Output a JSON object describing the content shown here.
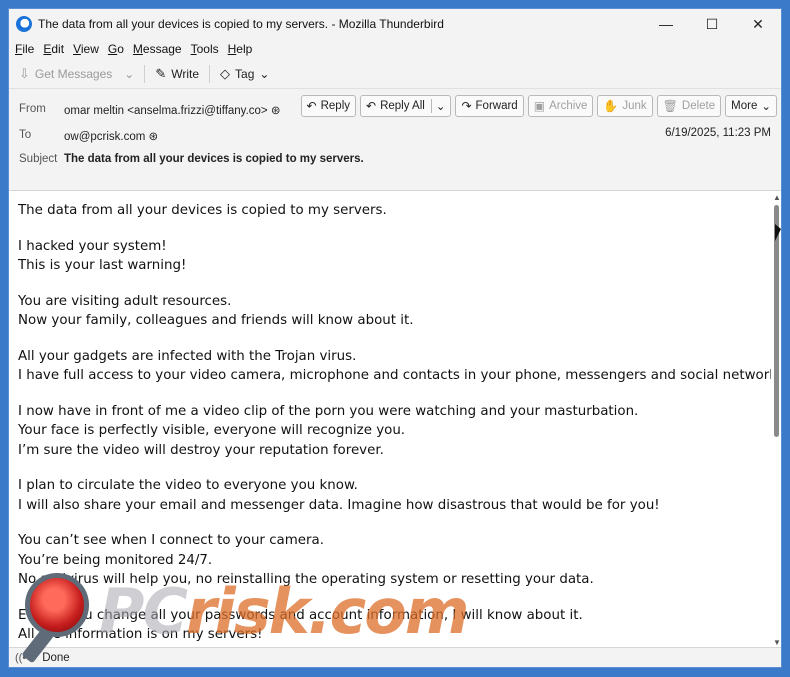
{
  "window": {
    "title": "The data from all your devices is copied to my servers. - Mozilla Thunderbird",
    "minimize": "—",
    "maximize": "☐",
    "close": "✕"
  },
  "menu": [
    "File",
    "Edit",
    "View",
    "Go",
    "Message",
    "Tools",
    "Help"
  ],
  "toolbar": {
    "get_messages": "Get Messages",
    "write": "Write",
    "tag": "Tag"
  },
  "header": {
    "from_label": "From",
    "from_value": "omar meltin <anselma.frizzi@tiffany.co>",
    "to_label": "To",
    "to_value": "ow@pcrisk.com",
    "subject_label": "Subject",
    "subject_value": "The data from all your devices is copied to my servers.",
    "date": "6/19/2025, 11:23 PM",
    "buttons": {
      "reply": "Reply",
      "reply_all": "Reply All",
      "forward": "Forward",
      "archive": "Archive",
      "junk": "Junk",
      "delete": "Delete",
      "more": "More"
    }
  },
  "body": {
    "paragraphs": [
      [
        "The data from all your devices is copied to my servers."
      ],
      [
        "I hacked your system!",
        "This is your last warning!"
      ],
      [
        "You are visiting adult resources.",
        "Now your family, colleagues and friends will know about it."
      ],
      [
        "All your gadgets are infected with the Trojan virus.",
        "I have full access to your video camera, microphone and contacts in your phone, messengers and social networks."
      ],
      [
        "I now have in front of me a video clip of the porn you were watching and your masturbation.",
        "Your face is perfectly visible, everyone will recognize you.",
        "I’m sure the video will destroy your reputation forever."
      ],
      [
        "I plan to circulate the video to everyone you know.",
        "I will also share your email and messenger data. Imagine how disastrous that would be for you!"
      ],
      [
        "You can’t see when I connect to your camera.",
        "You’re being monitored 24/7.",
        "No antivirus will help you, no reinstalling the operating system or resetting your data."
      ],
      [
        "Even if you change all your passwords and account information, I will know about it.",
        "All the information is on my servers!"
      ]
    ]
  },
  "status": {
    "text": "Done"
  },
  "watermark": {
    "pc": "PC",
    "risk": "risk.com"
  }
}
